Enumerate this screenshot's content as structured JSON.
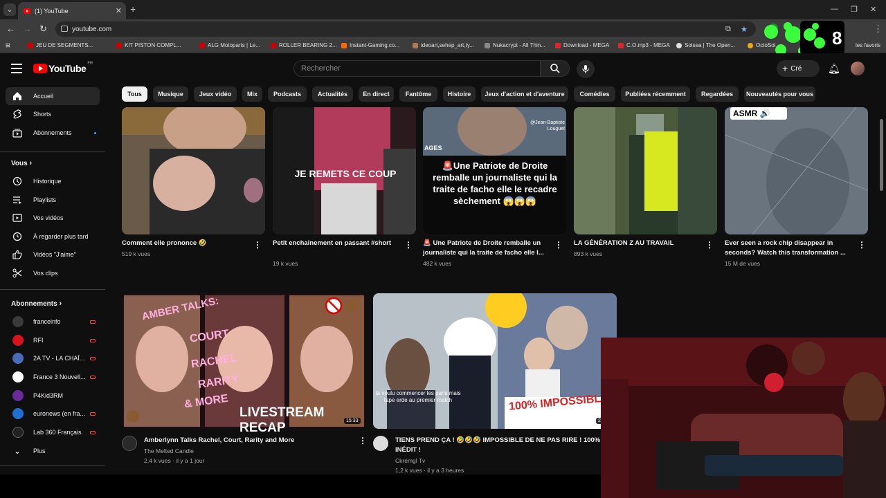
{
  "browser": {
    "tab_title": "(1) YouTube",
    "url": "youtube.com",
    "bookmarks": [
      {
        "label": "JEU DE SEGMENTS...",
        "color": "#cc0000"
      },
      {
        "label": "KIT PISTON COMPL...",
        "color": "#cc0000"
      },
      {
        "label": "ALG Motoparts | Le...",
        "color": "#cc0000"
      },
      {
        "label": "ROLLER BEARING 2...",
        "color": "#cc0000"
      },
      {
        "label": "Instant-Gaming.co...",
        "color": "#ff6600"
      },
      {
        "label": "ideoart,sehep_art,ty...",
        "color": "#b07a50"
      },
      {
        "label": "Nukacrypt - All Thin...",
        "color": "#888888"
      },
      {
        "label": "Download - MEGA",
        "color": "#d9272e"
      },
      {
        "label": "C.O.mp3 - MEGA",
        "color": "#d9272e"
      },
      {
        "label": "Solsea | The Open...",
        "color": "#e0e0e0"
      },
      {
        "label": "OctoSol",
        "color": "#f2a51a"
      },
      {
        "label": "les favoris",
        "color": "#999999"
      }
    ]
  },
  "header": {
    "logo_text": "YouTube",
    "logo_region": "FR",
    "search_placeholder": "Rechercher",
    "create_label": "Cré"
  },
  "overlay_number": "8",
  "chips": [
    "Tous",
    "Musique",
    "Jeux vidéo",
    "Mix",
    "Podcasts",
    "Actualités",
    "En direct",
    "Fantôme",
    "Histoire",
    "Jeux d'action et d'aventure",
    "Comédies",
    "Publiées récemment",
    "Regardées",
    "Nouveautés pour vous"
  ],
  "sidebar": {
    "main": [
      {
        "label": "Accueil",
        "icon": "home-icon"
      },
      {
        "label": "Shorts",
        "icon": "shorts-icon"
      },
      {
        "label": "Abonnements",
        "icon": "subscriptions-icon"
      }
    ],
    "you_heading": "Vous",
    "you": [
      {
        "label": "Historique",
        "icon": "history-icon"
      },
      {
        "label": "Playlists",
        "icon": "playlists-icon"
      },
      {
        "label": "Vos vidéos",
        "icon": "your-videos-icon"
      },
      {
        "label": "À regarder plus tard",
        "icon": "watch-later-icon"
      },
      {
        "label": "Vidéos \"J'aime\"",
        "icon": "liked-icon"
      },
      {
        "label": "Vos clips",
        "icon": "clips-icon"
      }
    ],
    "subs_heading": "Abonnements",
    "subs": [
      {
        "label": "franceinfo",
        "color": "#3a3a3a"
      },
      {
        "label": "RFI",
        "color": "#d6121c"
      },
      {
        "label": "2A TV - LA CHAÎ...",
        "color": "#4a6cb8"
      },
      {
        "label": "France 3 Nouvell...",
        "color": "#ffffff"
      },
      {
        "label": "P4Kid3RM",
        "color": "#6a2a9a"
      },
      {
        "label": "euronews (en fra...",
        "color": "#1e6fd0"
      },
      {
        "label": "Lab 360 Français",
        "color": "#222222"
      }
    ],
    "more_label": "Plus"
  },
  "shorts": [
    {
      "title": "Comment elle prononce 🤣",
      "views": "519 k vues"
    },
    {
      "title": "Petit enchaînement en passant #short",
      "views": "19 k vues",
      "overlay": "JE REMETS CE COUP"
    },
    {
      "title": "🚨 Une Patriote de Droite remballe un journaliste qui la traite de facho elle l...",
      "views": "482 k vues",
      "overlay": "🚨Une Patriote de Droite remballe un journaliste qui la traite de facho elle le recadre sèchement 😱😱😱",
      "handle": "@Jean-Baptiste Louguet",
      "tag": "AGES"
    },
    {
      "title": "LA GÉNÉRATION Z AU TRAVAIL",
      "views": "893 k vues"
    },
    {
      "title": "Ever seen a rock chip disappear in seconds? Watch this transformation ...",
      "views": "15 M de vues",
      "overlay": "ASMR 🔊"
    }
  ],
  "videos": [
    {
      "title": "Amberlynn Talks Rachel, Court, Rarity and More",
      "channel": "The Melted Candle",
      "meta": "2,4 k vues · il y a 1 jour",
      "duration": "15:33",
      "overlay_a": "AMBER TALKS:",
      "overlay_b": "COURT",
      "overlay_c": "RACHEL",
      "overlay_d": "RARITY",
      "overlay_e": "& MORE",
      "overlay_f": "LIVESTREAM RECAP"
    },
    {
      "title": "TIENS PREND ÇA ! 🤣🤣🤣 IMPOSSIBLE DE NE PAS RIRE ! 100% INÉDIT !",
      "channel": "Ckrémgl Tv",
      "meta": "1,2 k vues · il y a 3 heures",
      "duration": "2",
      "overlay_a": "100% IMPOSSIBL",
      "overlay_b": "ta voulu commencer les paris mais tape erde au premier match"
    }
  ]
}
